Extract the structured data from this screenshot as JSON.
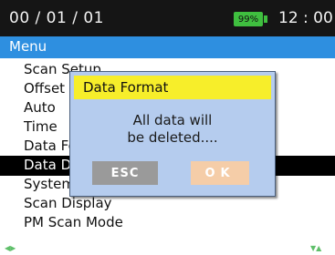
{
  "status": {
    "date": "00 / 01 / 01",
    "battery": "99%",
    "time": "12 : 00"
  },
  "menu": {
    "title": "Menu",
    "items": [
      {
        "label": "Scan Setup",
        "selected": false
      },
      {
        "label": "Offset",
        "selected": false
      },
      {
        "label": "Auto",
        "selected": false
      },
      {
        "label": "Time",
        "selected": false
      },
      {
        "label": "Data Format",
        "selected": false
      },
      {
        "label": "Data Delete",
        "selected": true
      },
      {
        "label": "System Info",
        "selected": false
      },
      {
        "label": "Scan Display",
        "selected": false
      },
      {
        "label": "PM Scan Mode",
        "selected": false
      }
    ]
  },
  "dialog": {
    "title": "Data Format",
    "message_line1": "All data will",
    "message_line2": "be deleted....",
    "esc_label": "ESC",
    "ok_label": "OK"
  },
  "icons": {
    "left_right": "left-right-arrows-icon",
    "up_down": "up-down-arrows-icon"
  },
  "colors": {
    "menu_header": "#2e8fe0",
    "battery": "#3fbf3f",
    "dialog_title_bg": "#f7ee2a",
    "dialog_bg": "#b5ccee",
    "esc_button": "#9a9a9a",
    "ok_button": "#f5cda8"
  }
}
